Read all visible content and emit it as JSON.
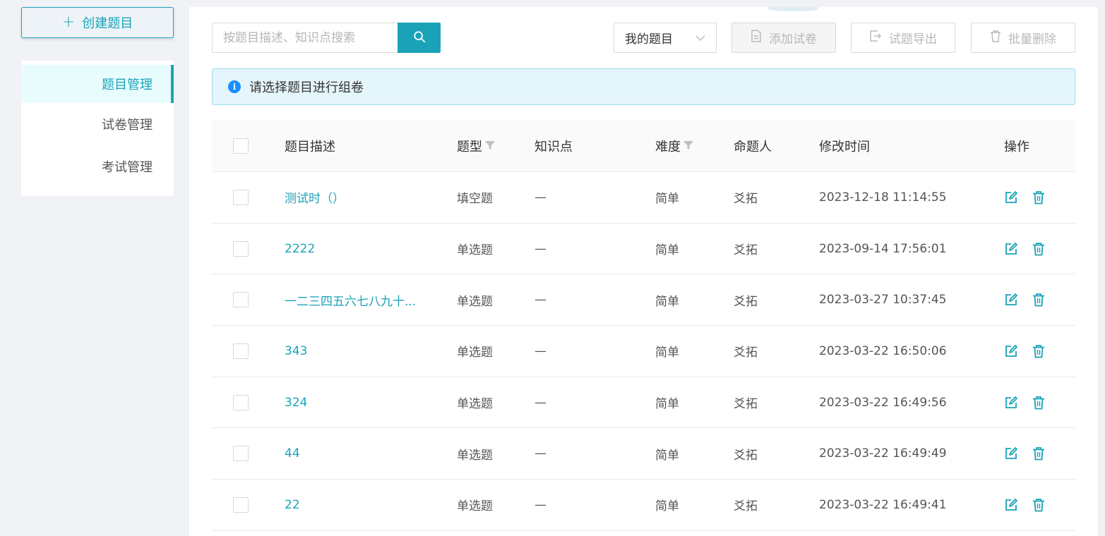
{
  "sidebar": {
    "create_label": "创建题目",
    "items": [
      {
        "label": "题目管理",
        "active": true
      },
      {
        "label": "试卷管理",
        "active": false
      },
      {
        "label": "考试管理",
        "active": false
      }
    ]
  },
  "toolbar": {
    "search_placeholder": "按题目描述、知识点搜索",
    "select_value": "我的题目",
    "add_label": "添加试卷",
    "export_label": "试题导出",
    "delete_label": "批量删除"
  },
  "alert": {
    "text": "请选择题目进行组卷"
  },
  "table": {
    "headers": {
      "desc": "题目描述",
      "type": "题型",
      "knowledge": "知识点",
      "difficulty": "难度",
      "author": "命题人",
      "time": "修改时间",
      "ops": "操作"
    },
    "rows": [
      {
        "desc": "测试时（）",
        "type": "填空题",
        "knowledge": "—",
        "difficulty": "简单",
        "author": "爻拓",
        "time": "2023-12-18 11:14:55"
      },
      {
        "desc": "2222",
        "type": "单选题",
        "knowledge": "—",
        "difficulty": "简单",
        "author": "爻拓",
        "time": "2023-09-14 17:56:01"
      },
      {
        "desc": "一二三四五六七八九十...",
        "type": "单选题",
        "knowledge": "—",
        "difficulty": "简单",
        "author": "爻拓",
        "time": "2023-03-27 10:37:45"
      },
      {
        "desc": "343",
        "type": "单选题",
        "knowledge": "—",
        "difficulty": "简单",
        "author": "爻拓",
        "time": "2023-03-22 16:50:06"
      },
      {
        "desc": "324",
        "type": "单选题",
        "knowledge": "—",
        "difficulty": "简单",
        "author": "爻拓",
        "time": "2023-03-22 16:49:56"
      },
      {
        "desc": "44",
        "type": "单选题",
        "knowledge": "—",
        "difficulty": "简单",
        "author": "爻拓",
        "time": "2023-03-22 16:49:49"
      },
      {
        "desc": "22",
        "type": "单选题",
        "knowledge": "—",
        "difficulty": "简单",
        "author": "爻拓",
        "time": "2023-03-22 16:49:41"
      }
    ]
  },
  "colors": {
    "accent": "#1aa3b7",
    "alert_bg": "#e4f5fb",
    "info_blue": "#1890ff"
  },
  "icons": {
    "create": "plus-icon",
    "search": "search-icon",
    "select": "chevron-down-icon",
    "add": "document-icon",
    "export": "export-icon",
    "delete": "trash-icon",
    "info": "info-icon",
    "filter": "filter-icon",
    "edit": "edit-icon"
  }
}
